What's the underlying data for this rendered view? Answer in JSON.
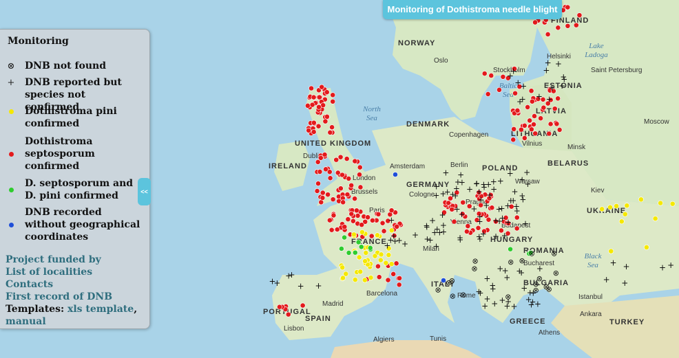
{
  "title_tab": "Monitoring of Dothistroma needle blight",
  "legend": {
    "title": "Monitoring",
    "items": [
      {
        "symbol": "⊗",
        "label": "DNB not found"
      },
      {
        "symbol": "+",
        "label": "DNB reported but species not confirmed"
      },
      {
        "color": "#f5e800",
        "label": "Dothistroma pini confirmed"
      },
      {
        "color": "#e31a1c",
        "label": "Dothistroma septosporum confirmed"
      },
      {
        "color": "#2ecc2e",
        "label": "D. septosporum and D. pini confirmed"
      },
      {
        "color": "#1f4fd8",
        "label": "DNB recorded without geographical coordinates"
      }
    ]
  },
  "links": {
    "project": "Project funded by",
    "localities": "List of localities",
    "contacts": "Contacts",
    "first_record": "First record of DNB",
    "templates_prefix": "Templates: ",
    "xls_template": "xls template",
    "separator": ",",
    "manual": "manual"
  },
  "collapse_button": "<<",
  "map": {
    "countries": [
      "NORWAY",
      "DENMARK",
      "UNITED KINGDOM",
      "IRELAND",
      "GERMANY",
      "POLAND",
      "BELARUS",
      "UKRAINE",
      "FRANCE",
      "ITALY",
      "SPAIN",
      "PORTUGAL",
      "HUNGARY",
      "ROMANIA",
      "BULGARIA",
      "GREECE",
      "TURKEY",
      "LITHUANIA",
      "LATVIA",
      "ESTONIA",
      "FINLAND"
    ],
    "cities": [
      "Oslo",
      "Stockholm",
      "Helsinki",
      "Saint Petersburg",
      "Copenhagen",
      "Vilnius",
      "Minsk",
      "Moscow",
      "Dublin",
      "London",
      "Amsterdam",
      "Berlin",
      "Warsaw",
      "Brussels",
      "Cologne",
      "Paris",
      "Prague",
      "Vienna",
      "Budapest",
      "Kiev",
      "Milan",
      "Bucharest",
      "Madrid",
      "Barcelona",
      "Rome",
      "Lisbon",
      "Algiers",
      "Tunis",
      "Istanbul",
      "Ankara",
      "Athens"
    ],
    "seas": [
      "North Sea",
      "Baltic Sea",
      "Black Sea",
      "Lake Ladoga"
    ]
  }
}
